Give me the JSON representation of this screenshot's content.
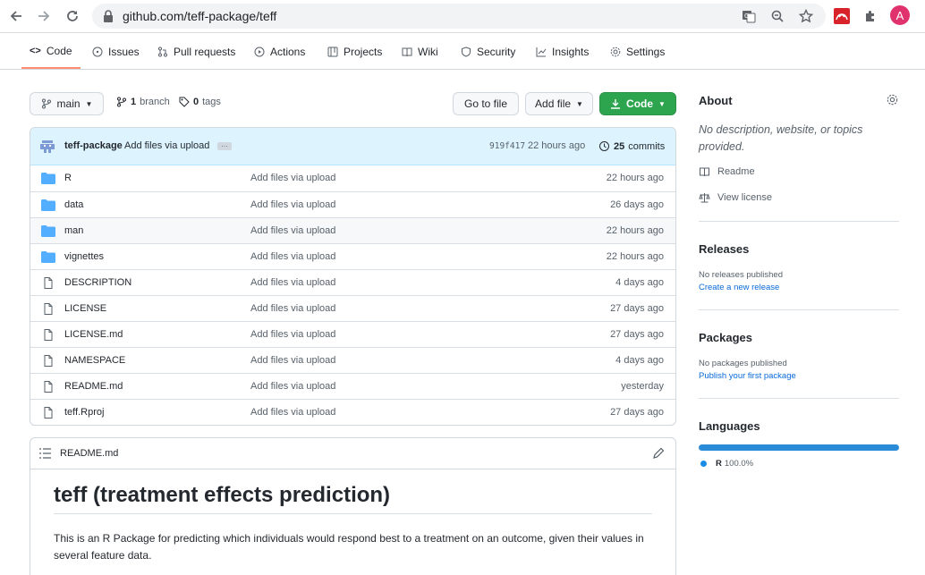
{
  "browser": {
    "url": "github.com/teff-package/teff",
    "profile_initial": "A"
  },
  "tabs": [
    {
      "label": "Code",
      "icon": "code-icon"
    },
    {
      "label": "Issues",
      "icon": "issue-icon"
    },
    {
      "label": "Pull requests",
      "icon": "pull-request-icon"
    },
    {
      "label": "Actions",
      "icon": "play-icon"
    },
    {
      "label": "Projects",
      "icon": "table-icon"
    },
    {
      "label": "Wiki",
      "icon": "book-icon"
    },
    {
      "label": "Security",
      "icon": "shield-icon"
    },
    {
      "label": "Insights",
      "icon": "graph-icon"
    },
    {
      "label": "Settings",
      "icon": "gear-icon"
    }
  ],
  "toolbar": {
    "branch": "main",
    "branch_count": "1",
    "branch_label": "branch",
    "tag_count": "0",
    "tag_label": "tags",
    "go_to_file": "Go to file",
    "add_file": "Add file",
    "code": "Code"
  },
  "commit": {
    "author": "teff-package",
    "message": "Add files via upload",
    "ellipsis": "…",
    "sha": "919f417",
    "ago": "22 hours ago",
    "count": "25",
    "count_label": "commits"
  },
  "files": [
    {
      "type": "dir",
      "name": "R",
      "message": "Add files via upload",
      "age": "22 hours ago"
    },
    {
      "type": "dir",
      "name": "data",
      "message": "Add files via upload",
      "age": "26 days ago"
    },
    {
      "type": "dir",
      "name": "man",
      "message": "Add files via upload",
      "age": "22 hours ago"
    },
    {
      "type": "dir",
      "name": "vignettes",
      "message": "Add files via upload",
      "age": "22 hours ago"
    },
    {
      "type": "file",
      "name": "DESCRIPTION",
      "message": "Add files via upload",
      "age": "4 days ago"
    },
    {
      "type": "file",
      "name": "LICENSE",
      "message": "Add files via upload",
      "age": "27 days ago"
    },
    {
      "type": "file",
      "name": "LICENSE.md",
      "message": "Add files via upload",
      "age": "27 days ago"
    },
    {
      "type": "file",
      "name": "NAMESPACE",
      "message": "Add files via upload",
      "age": "4 days ago"
    },
    {
      "type": "file",
      "name": "README.md",
      "message": "Add files via upload",
      "age": "yesterday"
    },
    {
      "type": "file",
      "name": "teff.Rproj",
      "message": "Add files via upload",
      "age": "27 days ago"
    }
  ],
  "readme": {
    "filename": "README.md",
    "title": "teff (treatment effects prediction)",
    "body": "This is an R Package for predicting which individuals would respond best to a treatment on an outcome, given their values in several feature data."
  },
  "sidebar": {
    "about_title": "About",
    "description": "No description, website, or topics provided.",
    "readme_link": "Readme",
    "license_link": "View license",
    "releases_title": "Releases",
    "releases_empty": "No releases published",
    "releases_create": "Create a new release",
    "packages_title": "Packages",
    "packages_empty": "No packages published",
    "packages_publish": "Publish your first package",
    "languages_title": "Languages",
    "language_name": "R",
    "language_pct": "100.0%"
  },
  "colors": {
    "accent_green": "#2da44e",
    "tab_underline": "#fd8c73",
    "link_blue": "#0969da",
    "language_r": "#198ce7"
  }
}
